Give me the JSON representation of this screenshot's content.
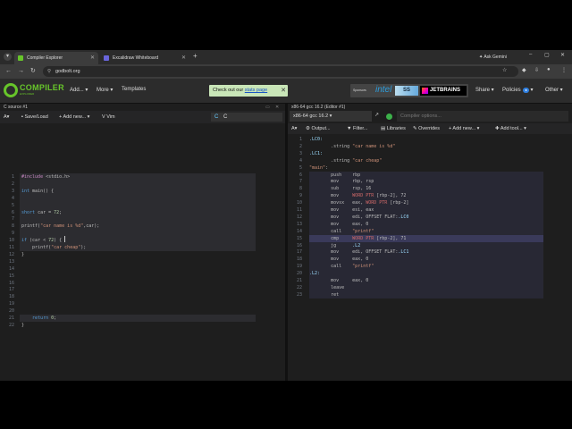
{
  "browser": {
    "tabs": [
      {
        "label": "Compiler Explorer",
        "active": true
      },
      {
        "label": "Excalidraw Whiteboard",
        "active": false
      }
    ],
    "url": "godbolt.org",
    "ask_label": "Ask Gemini"
  },
  "header": {
    "logo": "COMPILER",
    "logo_sub": "EXPLORER",
    "menu": [
      "Add...",
      "More",
      "Templates"
    ],
    "banner_text": "Check out our ",
    "banner_link": "stats page",
    "sponsors_label": "Sponsors",
    "sponsor_intel": "intel",
    "sponsor_jb": "JETBRAINS",
    "share": "Share",
    "policies": "Policies",
    "other": "Other"
  },
  "source_pane": {
    "tab": "C source #1",
    "save_label": "Save/Load",
    "add_new_label": "Add new...",
    "vim_label": "Vim",
    "language": "C",
    "lines": [
      "#include <stdio.h>",
      "",
      "int main() {",
      "",
      "",
      "short car = 72;",
      "",
      "printf(\"car name is %d\",car);",
      "",
      "if (car < 72) {",
      "    printf(\"car cheap\");",
      "}",
      "",
      "",
      "",
      "",
      "",
      "",
      "",
      "",
      "    return 0;",
      "}"
    ]
  },
  "output_pane": {
    "tab": "x86-64 gcc 16.2 (Editor #1)",
    "compiler": "x86-64 gcc 16.2",
    "options_placeholder": "Compiler options...",
    "toolbar": [
      "Output...",
      "Filter...",
      "Libraries",
      "Overrides",
      "+ Add new...",
      "Add tool..."
    ],
    "lines": [
      ".LC0:",
      "        .string \"car name is %d\"",
      ".LC1:",
      "        .string \"car cheap\"",
      "\"main\":",
      "        push    rbp",
      "        mov     rbp, rsp",
      "        sub     rsp, 16",
      "        mov     WORD PTR [rbp-2], 72",
      "        movsx   eax, WORD PTR [rbp-2]",
      "        mov     esi, eax",
      "        mov     edi, OFFSET FLAT:.LC0",
      "        mov     eax, 0",
      "        call    \"printf\"",
      "        cmp     WORD PTR [rbp-2], 71",
      "        jg      .L2",
      "        mov     edi, OFFSET FLAT:.LC1",
      "        mov     eax, 0",
      "        call    \"printf\"",
      ".L2:",
      "        mov     eax, 0",
      "        leave",
      "        ret"
    ]
  }
}
